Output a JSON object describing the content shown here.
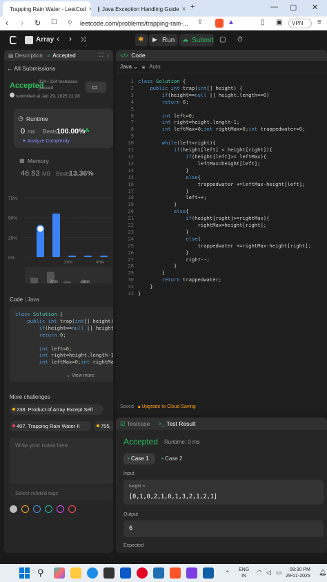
{
  "browser": {
    "tabs": [
      {
        "title": "Trapping Rain Water - LeetCod"
      },
      {
        "title": "Java Exception Handling Guide"
      }
    ],
    "url": "leetcode.com/problems/trapping-rain-...",
    "vpn_label": "VPN"
  },
  "lc_nav": {
    "problem_list_label": "Array",
    "run_label": "Run",
    "submit_label": "Submit"
  },
  "left_panel": {
    "tabs": [
      "Description",
      "Accepted"
    ],
    "back_label": "All Submissions",
    "status": "Accepted",
    "testcases": "324 / 324 testcases passed",
    "submitted": "submitted at Jan 29, 2025 21:28",
    "runtime": {
      "label": "Runtime",
      "value": "0",
      "unit": "ms",
      "beats_label": "Beats",
      "beats": "100.00%",
      "analyze": "Analyze Complexity"
    },
    "memory": {
      "label": "Memory",
      "value": "46.83",
      "unit": "MB",
      "beats_label": "Beats",
      "beats": "13.36%"
    },
    "code_header": {
      "code": "Code",
      "lang": "Java"
    },
    "code_preview": [
      "class Solution {",
      "    public int trap(int[] height) {",
      "        if(height==null || height",
      "        return 0;",
      "",
      "        int left=0;",
      "        int right=height.length-1",
      "        int leftMax=0;int rightMa"
    ],
    "view_more": "View more",
    "more_challenges": "More challenges",
    "challenges": [
      "238. Product of Array Except Self",
      "407. Trapping Rain Water II",
      "755."
    ],
    "notes_placeholder": "Write your notes here",
    "tags_placeholder": "Select related tags",
    "note_colors": [
      "#bbbbbb",
      "#f5a623",
      "#4a90e2",
      "#1abc9c",
      "#e040fb",
      "#ff5252"
    ]
  },
  "chart_data": {
    "type": "bar",
    "y_ticks": [
      "75%",
      "50%",
      "25%",
      "0%"
    ],
    "x_ticks": [
      "2ms",
      "4ms"
    ],
    "ylim": [
      0,
      75
    ],
    "values": [
      34,
      55,
      2,
      2,
      2,
      2
    ],
    "mini_x_ticks": [
      "2ms",
      "4ms"
    ],
    "mini_values": [
      0.35,
      0.7,
      0.12,
      0.12
    ]
  },
  "editor": {
    "title": "Code",
    "lang": "Java",
    "auto": "Auto",
    "lines": [
      "class Solution {",
      "    public int trap(int[] height) {",
      "        if(height==null || height.length==0)",
      "        return 0;",
      "",
      "        int left=0;",
      "        int right=height.length-1;",
      "        int leftMax=0;int rightMax=0;int trappedwater=0;",
      "",
      "        while(left<right){",
      "            if(height[left] < height[right]){",
      "                if(height[left]>= leftMax){",
      "                    leftMax=height[left];",
      "                }",
      "                else{",
      "                    trappedwater +=leftMax-height[left];",
      "                }",
      "                left++;",
      "            }",
      "            else{",
      "                if(height[right]>=rightMax){",
      "                    rightMax=height[right];",
      "                }",
      "                else{",
      "                    trappedwater +=rightMax-height[right];",
      "                }",
      "                right--;",
      "            }",
      "        }",
      "        return trappedwater;",
      "    }",
      "}"
    ],
    "saved": "Saved",
    "upgrade": "Upgrade to Cloud Saving"
  },
  "result": {
    "tabs": [
      "Testcase",
      "Test Result"
    ],
    "status": "Accepted",
    "runtime": "Runtime: 0 ms",
    "cases": [
      "Case 1",
      "Case 2"
    ],
    "input_label": "Input",
    "param": "height =",
    "input_value": "[0,1,0,2,1,0,1,3,2,1,2,1]",
    "output_label": "Output",
    "output_value": "6",
    "expected_label": "Expected"
  },
  "taskbar": {
    "lang": "ENG",
    "region": "IN",
    "time": "09:30 PM",
    "date": "29-01-2025"
  }
}
